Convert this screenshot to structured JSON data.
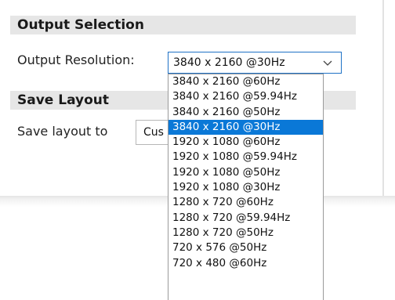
{
  "output_selection": {
    "header": "Output Selection",
    "resolution_label": "Output Resolution:",
    "selected_value": "3840 x 2160 @30Hz",
    "options": [
      "3840 x 2160 @60Hz",
      "3840 x 2160 @59.94Hz",
      "3840 x 2160 @50Hz",
      "3840 x 2160 @30Hz",
      "1920 x 1080 @60Hz",
      "1920 x 1080 @59.94Hz",
      "1920 x 1080 @50Hz",
      "1920 x 1080 @30Hz",
      "1280 x 720 @60Hz",
      "1280 x 720 @59.94Hz",
      "1280 x 720 @50Hz",
      "720 x 576 @50Hz",
      "720 x 480 @60Hz"
    ],
    "highlighted_index": 3
  },
  "save_layout": {
    "header": "Save Layout",
    "label": "Save layout to",
    "field_value_visible": "Cus"
  },
  "icons": {
    "dropdown_chevron": "chevron-down-icon"
  },
  "colors": {
    "selection_highlight": "#0a78d7",
    "focus_border": "#1f72c6",
    "section_header_bg": "#e6e6e6"
  }
}
